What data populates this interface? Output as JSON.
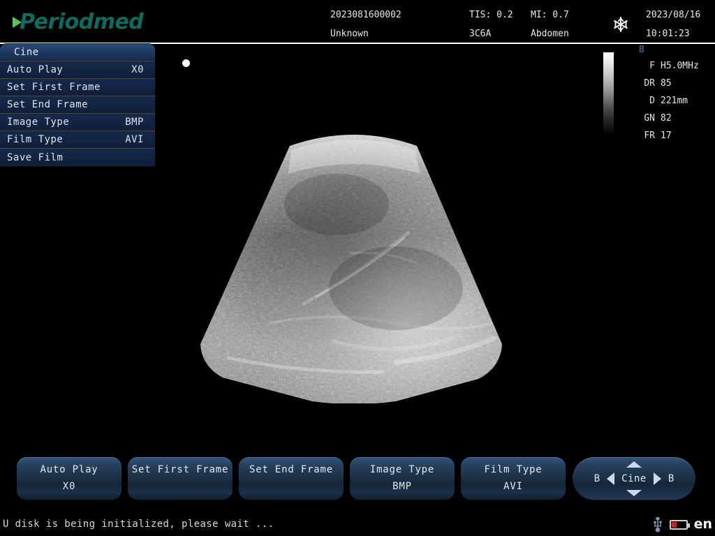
{
  "brand": {
    "name": "Periodmed",
    "logo_color": "#0e6b5e",
    "accent_color": "#5fbf5f"
  },
  "header": {
    "patient_id": "2023081600002",
    "patient_name": "Unknown",
    "tis": "TIS: 0.2",
    "probe": "3C6A",
    "mi": "MI: 0.7",
    "exam_region": "Abdomen",
    "date": "2023/08/16",
    "time": "10:01:23",
    "freeze_icon": "snowflake-icon"
  },
  "cine_menu": {
    "title": "Cine",
    "items": [
      {
        "label": "Auto Play",
        "value": "X0"
      },
      {
        "label": "Set First Frame",
        "value": ""
      },
      {
        "label": "Set End Frame",
        "value": ""
      },
      {
        "label": "Image Type",
        "value": "BMP"
      },
      {
        "label": "Film Type",
        "value": "AVI"
      },
      {
        "label": "Save Film",
        "value": ""
      }
    ]
  },
  "imaging_params": {
    "mode": "B",
    "rows": [
      {
        "key": "F",
        "value": "H5.0MHz"
      },
      {
        "key": "DR",
        "value": "85"
      },
      {
        "key": "D",
        "value": "221mm"
      },
      {
        "key": "GN",
        "value": "82"
      },
      {
        "key": "FR",
        "value": "17"
      }
    ]
  },
  "buttons": [
    {
      "label": "Auto Play",
      "sub": "X0"
    },
    {
      "label": "Set First Frame",
      "sub": ""
    },
    {
      "label": "Set End Frame",
      "sub": ""
    },
    {
      "label": "Image Type",
      "sub": "BMP"
    },
    {
      "label": "Film Type",
      "sub": "AVI"
    }
  ],
  "nav_pad": {
    "left_label": "B",
    "center_label": "Cine",
    "right_label": "B",
    "up_icon": "chevron-up-icon",
    "down_icon": "chevron-down-icon",
    "prev_icon": "triangle-left-icon",
    "next_icon": "triangle-right-icon"
  },
  "status_bar": {
    "message": "U disk is being initialized, please wait ...",
    "usb_icon": "usb-icon",
    "battery_icon": "battery-icon",
    "battery_color": "#cc2222",
    "language": "en"
  },
  "image_area": {
    "cursor_marker": "cursor-dot",
    "grayscale_bar": "grayscale-reference-bar",
    "scan_type": "convex-sector-b-mode"
  }
}
